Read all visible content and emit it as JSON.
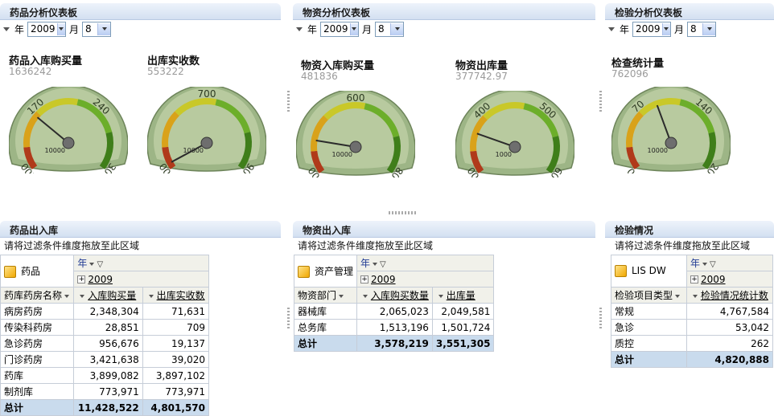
{
  "panels": {
    "drug_dash": {
      "title": "药品分析仪表板"
    },
    "mat_dash": {
      "title": "物资分析仪表板"
    },
    "lab_dash": {
      "title": "检验分析仪表板"
    },
    "drug_io": {
      "title": "药品出入库"
    },
    "mat_io": {
      "title": "物资出入库"
    },
    "lab_status": {
      "title": "检验情况"
    }
  },
  "selector": {
    "year_label": "年",
    "month_label": "月",
    "year": "2009",
    "month": "8"
  },
  "gauges": [
    {
      "title": "药品入库购买量",
      "value": "1636242",
      "ticks": [
        "100",
        "170",
        "240",
        "300"
      ],
      "center": "10000",
      "needle": 0.3
    },
    {
      "title": "出库实收数",
      "value": "553222",
      "ticks": [
        "500",
        "700",
        "900"
      ],
      "center": "10000",
      "needle": 0.03
    },
    {
      "title": "物资入库购买量",
      "value": "481836",
      "ticks": [
        "400",
        "600",
        "800"
      ],
      "center": "10000",
      "needle": 0.18
    },
    {
      "title": "物资出库量",
      "value": "377742.97",
      "ticks": [
        "300",
        "400",
        "500",
        "600"
      ],
      "center": "1000",
      "needle": 0.22
    },
    {
      "title": "检查统计量",
      "value": "762096",
      "ticks": [
        "0",
        "70",
        "140",
        "200"
      ],
      "center": "10000",
      "needle": 0.42
    }
  ],
  "filter_hint": "请将过滤条件维度拖放至此区域",
  "drug_table": {
    "cube": "药品",
    "year_field": "年",
    "year_value": "2009",
    "row_header": "药库药房名称",
    "col1": "入库购买量",
    "col2": "出库实收数",
    "rows": [
      {
        "name": "病房药房",
        "a": "2,348,304",
        "b": "71,631"
      },
      {
        "name": "传染科药房",
        "a": "28,851",
        "b": "709"
      },
      {
        "name": "急诊药房",
        "a": "956,676",
        "b": "19,137"
      },
      {
        "name": "门诊药房",
        "a": "3,421,638",
        "b": "39,020"
      },
      {
        "name": "药库",
        "a": "3,899,082",
        "b": "3,897,102"
      },
      {
        "name": "制剂库",
        "a": "773,971",
        "b": "773,971"
      }
    ],
    "total_label": "总计",
    "total_a": "11,428,522",
    "total_b": "4,801,570"
  },
  "mat_table": {
    "cube": "资产管理",
    "year_field": "年",
    "year_value": "2009",
    "row_header": "物资部门",
    "col1": "入库购买数量",
    "col2": "出库量",
    "rows": [
      {
        "name": "器械库",
        "a": "2,065,023",
        "b": "2,049,581"
      },
      {
        "name": "总务库",
        "a": "1,513,196",
        "b": "1,501,724"
      }
    ],
    "total_label": "总计",
    "total_a": "3,578,219",
    "total_b": "3,551,305"
  },
  "lab_table": {
    "cube": "LIS DW",
    "year_field": "年",
    "year_value": "2009",
    "row_header": "检验项目类型",
    "col1": "检验情况统计数",
    "rows": [
      {
        "name": "常规",
        "a": "4,767,584"
      },
      {
        "name": "急诊",
        "a": "53,042"
      },
      {
        "name": "质控",
        "a": "262"
      }
    ],
    "total_label": "总计",
    "total_a": "4,820,888"
  }
}
